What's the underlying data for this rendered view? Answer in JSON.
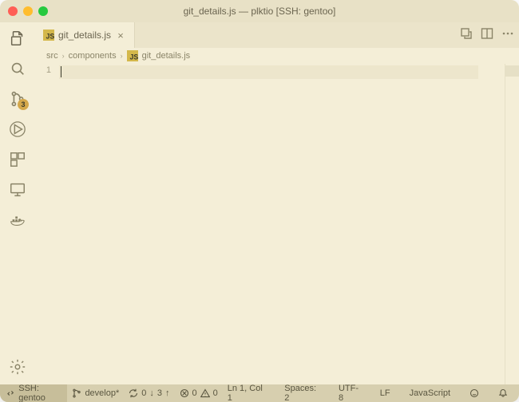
{
  "window": {
    "title": "git_details.js — plktio [SSH: gentoo]"
  },
  "tab": {
    "icon": "js",
    "label": "git_details.js",
    "close": "×"
  },
  "tabbar_actions": [
    "compare",
    "split-right",
    "more"
  ],
  "breadcrumb": {
    "parts": [
      "src",
      "components",
      "git_details.js"
    ],
    "sep": "›"
  },
  "gutter": {
    "line1": "1"
  },
  "activity": {
    "items": [
      "explorer",
      "search",
      "source-control",
      "run-debug",
      "extensions",
      "remote-explorer",
      "docker"
    ],
    "scm_badge": "3"
  },
  "statusbar": {
    "remote": "SSH: gentoo",
    "branch": "develop*",
    "sync": {
      "down": "0",
      "up": "3"
    },
    "problems": {
      "errors": "0",
      "warnings": "0"
    },
    "cursor": "Ln 1, Col 1",
    "spaces": "Spaces: 2",
    "encoding": "UTF-8",
    "eol": "LF",
    "language": "JavaScript"
  }
}
